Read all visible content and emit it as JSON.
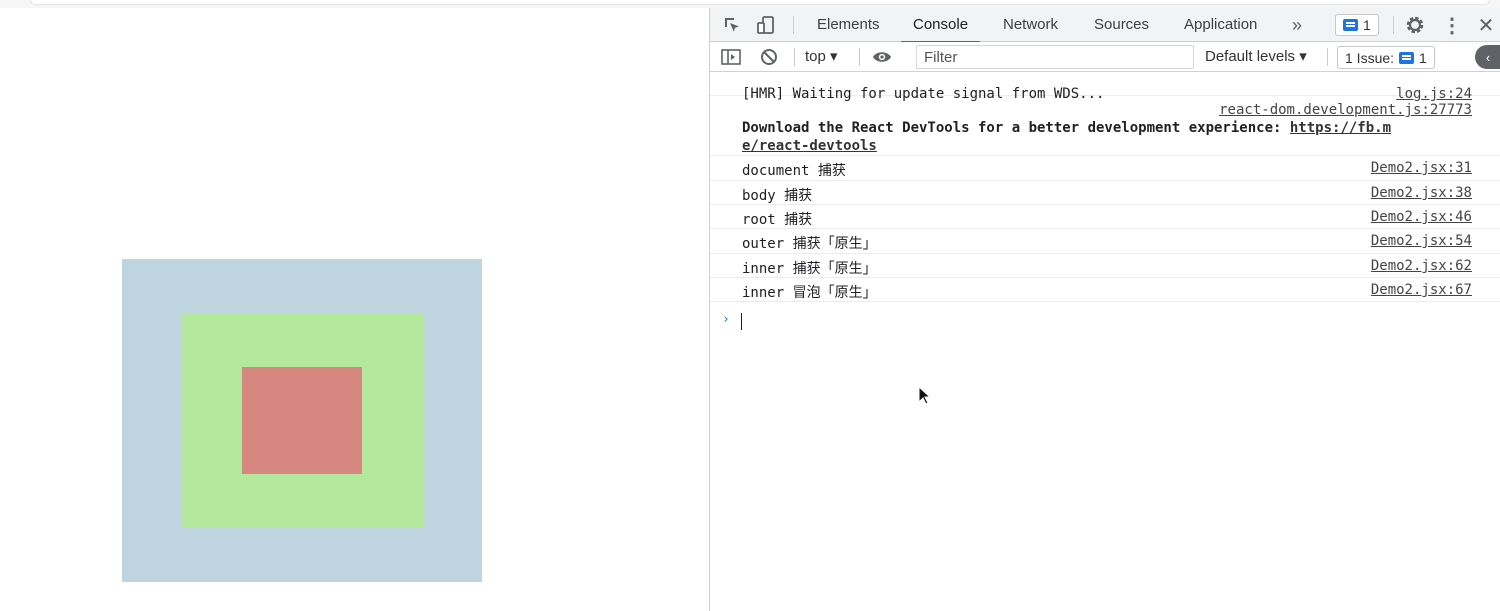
{
  "devtools": {
    "tabs": [
      {
        "label": "Elements"
      },
      {
        "label": "Console"
      },
      {
        "label": "Network"
      },
      {
        "label": "Sources"
      },
      {
        "label": "Application"
      }
    ],
    "more_tabs_icon": "chevron-double-right-icon",
    "message_badge_count": "1",
    "toolbar": {
      "context": "top",
      "filter_placeholder": "Filter",
      "levels": "Default levels",
      "issues_label": "1 Issue:",
      "issues_count": "1"
    },
    "console": {
      "rows": [
        {
          "message": "[HMR] Waiting for update signal from WDS...",
          "source": "log.js:24"
        },
        {
          "source": "react-dom.development.js:27773",
          "message": "Download the React DevTools for a better development experience: ",
          "link_part1": "https://fb.m",
          "link_part2": "e/react-devtools"
        },
        {
          "message": "document 捕获",
          "source": "Demo2.jsx:31"
        },
        {
          "message": "body 捕获",
          "source": "Demo2.jsx:38"
        },
        {
          "message": "root 捕获",
          "source": "Demo2.jsx:46"
        },
        {
          "message": "outer 捕获「原生」",
          "source": "Demo2.jsx:54"
        },
        {
          "message": "inner 捕获「原生」",
          "source": "Demo2.jsx:62"
        },
        {
          "message": "inner 冒泡「原生」",
          "source": "Demo2.jsx:67"
        }
      ],
      "prompt": "›"
    }
  },
  "page": {
    "outer_color": "#bed5e0",
    "middle_color": "#b4e89d",
    "inner_color": "#d6877f"
  }
}
